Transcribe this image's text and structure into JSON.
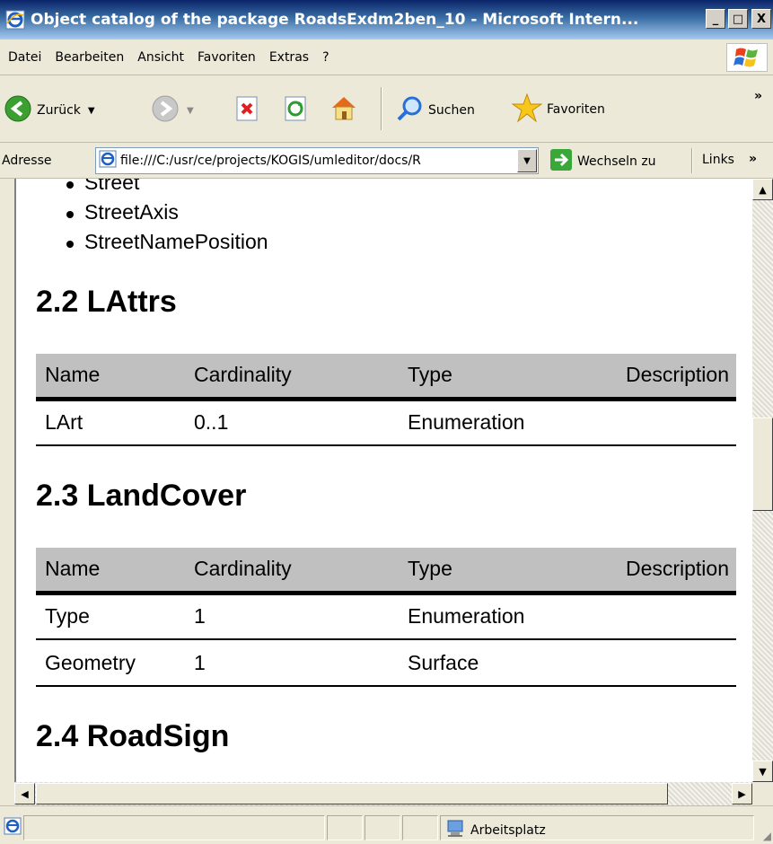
{
  "window": {
    "title": "Object catalog of the package RoadsExdm2ben_10 - Microsoft Intern...",
    "minimize": "_",
    "maximize": "□",
    "close": "X"
  },
  "menu": [
    "Datei",
    "Bearbeiten",
    "Ansicht",
    "Favoriten",
    "Extras",
    "?"
  ],
  "toolbar": {
    "back_label": "Zurück",
    "search_label": "Suchen",
    "favorites_label": "Favoriten",
    "overflow": "»"
  },
  "addressbar": {
    "label": "Adresse",
    "url": "file:///C:/usr/ce/projects/KOGIS/umleditor/docs/R",
    "go_label": "Wechseln zu",
    "links_label": "Links",
    "links_overflow": "»"
  },
  "content": {
    "list_items": [
      "Street",
      "StreetAxis",
      "StreetNamePosition"
    ],
    "table_headers": [
      "Name",
      "Cardinality",
      "Type",
      "Description"
    ],
    "sections": [
      {
        "heading": "2.2 LAttrs",
        "rows": [
          [
            "LArt",
            "0..1",
            "Enumeration",
            ""
          ]
        ]
      },
      {
        "heading": "2.3 LandCover",
        "rows": [
          [
            "Type",
            "1",
            "Enumeration",
            ""
          ],
          [
            "Geometry",
            "1",
            "Surface",
            ""
          ]
        ]
      },
      {
        "heading": "2.4 RoadSign",
        "rows": []
      }
    ]
  },
  "statusbar": {
    "zone_label": "Arbeitsplatz"
  }
}
